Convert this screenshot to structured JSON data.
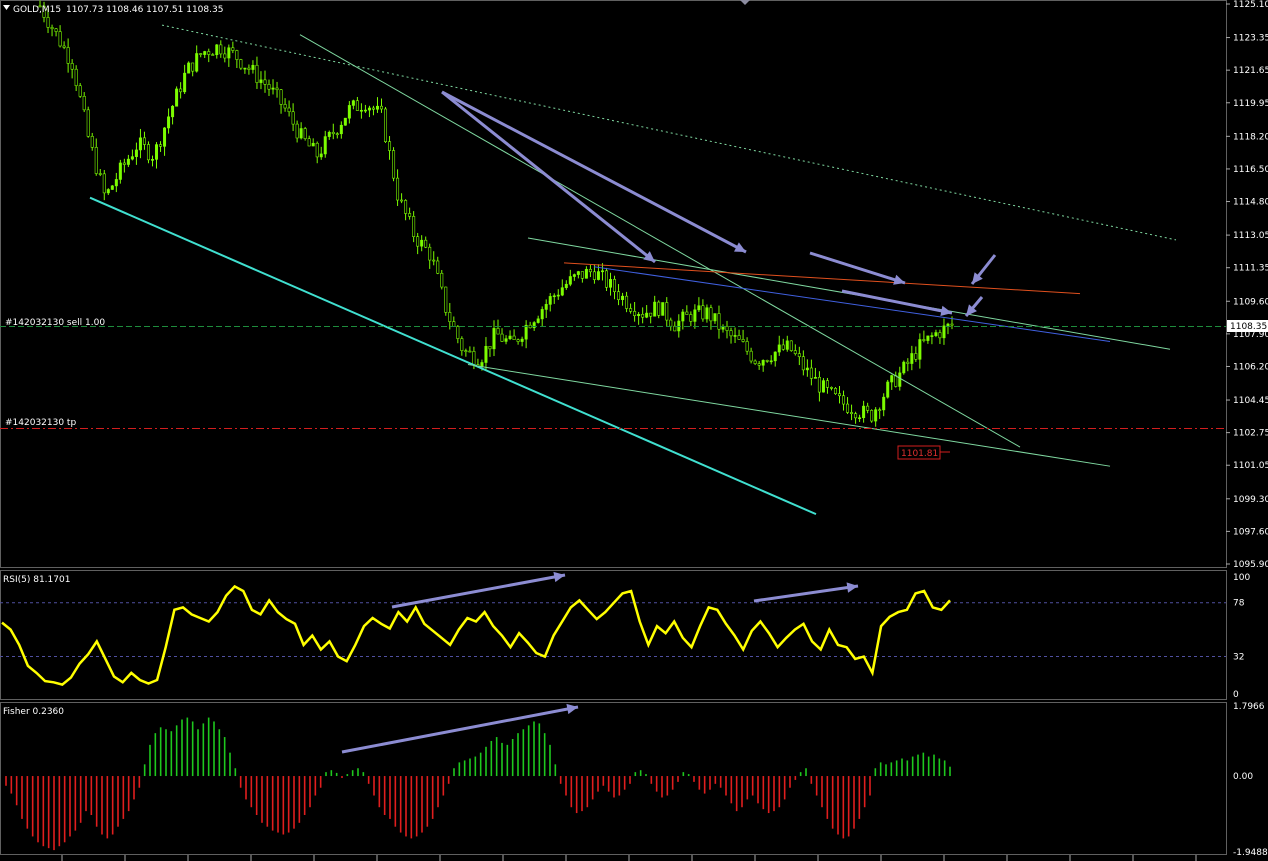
{
  "colors": {
    "background": "#000000",
    "bull_candle": "#7CFC00",
    "rsi_line": "#FFFF00",
    "fisher_pos": "#1EC81E",
    "fisher_neg": "#E01E1E",
    "arrow": "#8C8CD2",
    "trend_cyan": "#40E0D0",
    "trend_green": "#7FD8A0",
    "trend_red": "#E0501E",
    "trend_blue": "#4060E0",
    "order_line": "#1E8C3C",
    "tp_line": "#D21E1E",
    "grid": "#606060"
  },
  "header": {
    "symbol": "GOLD,M15",
    "ohlc": "1107.73 1108.46 1107.51 1108.35"
  },
  "orders": {
    "sell_label": "#142032130 sell 1.00",
    "tp_label": "#142032130 tp"
  },
  "price_axis": {
    "ticks": [
      "1125.10",
      "1123.35",
      "1121.65",
      "1119.95",
      "1118.20",
      "1116.50",
      "1114.80",
      "1113.05",
      "1111.35",
      "1109.60",
      "1107.90",
      "1106.20",
      "1104.45",
      "1102.75",
      "1101.05",
      "1099.30",
      "1097.60",
      "1095.90"
    ],
    "current_price": "1108.35",
    "marker_price": "1101.81"
  },
  "rsi": {
    "label": "RSI(5) 81.1701",
    "ticks": [
      "100",
      "78",
      "32",
      "0"
    ]
  },
  "fisher": {
    "label": "Fisher 0.2360",
    "ticks": [
      "1.7966",
      "0.00",
      "-1.9488"
    ]
  },
  "chart_data": [
    {
      "type": "candlestick",
      "title": "GOLD,M15",
      "ylim": [
        1095.9,
        1125.1
      ],
      "close_path": [
        1125.0,
        1123.5,
        1122.0,
        1118.0,
        1115.0,
        1116.5,
        1117.8,
        1117.2,
        1119.5,
        1121.6,
        1122.6,
        1122.9,
        1122.4,
        1121.6,
        1120.8,
        1119.7,
        1118.2,
        1117.2,
        1118.4,
        1119.6,
        1120.0,
        1119.2,
        1115.0,
        1113.0,
        1112.0,
        1109.0,
        1107.0,
        1106.6,
        1107.9,
        1107.3,
        1108.5,
        1109.4,
        1110.3,
        1110.9,
        1111.2,
        1110.4,
        1109.6,
        1109.0,
        1109.3,
        1108.4,
        1108.9,
        1109.0,
        1108.0,
        1107.4,
        1106.5,
        1106.9,
        1107.2,
        1106.0,
        1105.1,
        1104.4,
        1104.0,
        1103.6,
        1105.0,
        1106.0,
        1107.2,
        1107.9,
        1108.35
      ],
      "trend_lines": [
        {
          "color": "cyan",
          "from": [
            15,
            1115.0
          ],
          "to": [
            136,
            1098.5
          ]
        },
        {
          "color": "green",
          "from": [
            50,
            1123.5
          ],
          "to": [
            170,
            1102.0
          ]
        },
        {
          "color": "green_dotted",
          "from": [
            27,
            1124.0
          ],
          "to": [
            196,
            1112.8
          ]
        },
        {
          "color": "green",
          "from": [
            88,
            1112.9
          ],
          "to": [
            195,
            1107.1
          ]
        },
        {
          "color": "green",
          "from": [
            78,
            1106.3
          ],
          "to": [
            185,
            1101.0
          ]
        },
        {
          "color": "red",
          "from": [
            94,
            1111.6
          ],
          "to": [
            180,
            1110.0
          ]
        },
        {
          "color": "blue",
          "from": [
            99,
            1111.4
          ],
          "to": [
            185,
            1107.5
          ]
        }
      ]
    },
    {
      "type": "line",
      "title": "RSI(5) 81.1701",
      "ylim": [
        0,
        100
      ],
      "reference_levels": [
        78,
        32
      ],
      "values": [
        61,
        55,
        42,
        24,
        18,
        11,
        10,
        8,
        14,
        26,
        34,
        45,
        30,
        15,
        10,
        18,
        12,
        9,
        12,
        40,
        72,
        74,
        68,
        65,
        62,
        70,
        84,
        92,
        88,
        72,
        68,
        80,
        70,
        64,
        60,
        42,
        50,
        38,
        45,
        32,
        28,
        42,
        58,
        65,
        60,
        56,
        70,
        62,
        74,
        60,
        54,
        48,
        42,
        55,
        65,
        62,
        70,
        58,
        50,
        40,
        52,
        44,
        35,
        32,
        50,
        62,
        74,
        80,
        72,
        64,
        70,
        78,
        86,
        88,
        62,
        42,
        58,
        52,
        62,
        48,
        40,
        58,
        74,
        72,
        60,
        50,
        38,
        54,
        62,
        52,
        40,
        48,
        55,
        60,
        45,
        38,
        55,
        42,
        40,
        30,
        32,
        18,
        58,
        66,
        70,
        72,
        86,
        88,
        74,
        72,
        80
      ]
    },
    {
      "type": "bar",
      "title": "Fisher 0.2360",
      "ylim": [
        -1.9488,
        1.7966
      ],
      "values": [
        -0.25,
        -0.45,
        -0.75,
        -1.1,
        -1.35,
        -1.55,
        -1.7,
        -1.8,
        -1.85,
        -1.9,
        -1.8,
        -1.7,
        -1.55,
        -1.4,
        -1.2,
        -0.9,
        -1.0,
        -1.3,
        -1.5,
        -1.6,
        -1.5,
        -1.3,
        -1.1,
        -0.9,
        -0.6,
        -0.3,
        0.3,
        0.8,
        1.1,
        1.25,
        1.2,
        1.15,
        1.3,
        1.45,
        1.5,
        1.4,
        1.2,
        1.35,
        1.5,
        1.4,
        1.2,
        1.0,
        0.6,
        0.2,
        -0.3,
        -0.6,
        -0.8,
        -1.0,
        -1.2,
        -1.3,
        -1.4,
        -1.45,
        -1.5,
        -1.45,
        -1.35,
        -1.2,
        -1.0,
        -0.8,
        -0.5,
        -0.3,
        0.1,
        0.15,
        0.08,
        -0.05,
        0.05,
        0.15,
        0.2,
        0.1,
        -0.2,
        -0.5,
        -0.8,
        -1.0,
        -1.1,
        -1.3,
        -1.45,
        -1.55,
        -1.6,
        -1.55,
        -1.45,
        -1.3,
        -1.1,
        -0.8,
        -0.5,
        -0.2,
        0.2,
        0.35,
        0.4,
        0.45,
        0.5,
        0.6,
        0.75,
        0.9,
        1.0,
        0.85,
        0.8,
        0.95,
        1.1,
        1.2,
        1.3,
        1.4,
        1.35,
        1.1,
        0.8,
        0.3,
        -0.2,
        -0.5,
        -0.8,
        -0.95,
        -0.9,
        -0.8,
        -0.6,
        -0.4,
        -0.25,
        -0.4,
        -0.55,
        -0.5,
        -0.35,
        -0.2,
        0.1,
        0.15,
        0.05,
        -0.2,
        -0.4,
        -0.55,
        -0.5,
        -0.35,
        -0.15,
        0.1,
        0.05,
        -0.15,
        -0.35,
        -0.45,
        -0.35,
        -0.2,
        -0.3,
        -0.5,
        -0.7,
        -0.9,
        -0.8,
        -0.6,
        -0.5,
        -0.7,
        -0.85,
        -0.95,
        -0.9,
        -0.8,
        -0.6,
        -0.3,
        -0.1,
        0.1,
        0.2,
        -0.2,
        -0.5,
        -0.8,
        -1.1,
        -1.35,
        -1.5,
        -1.6,
        -1.55,
        -1.35,
        -1.1,
        -0.8,
        -0.5,
        0.2,
        0.35,
        0.3,
        0.35,
        0.4,
        0.45,
        0.4,
        0.5,
        0.55,
        0.6,
        0.5,
        0.55,
        0.45,
        0.4,
        0.24
      ]
    }
  ]
}
